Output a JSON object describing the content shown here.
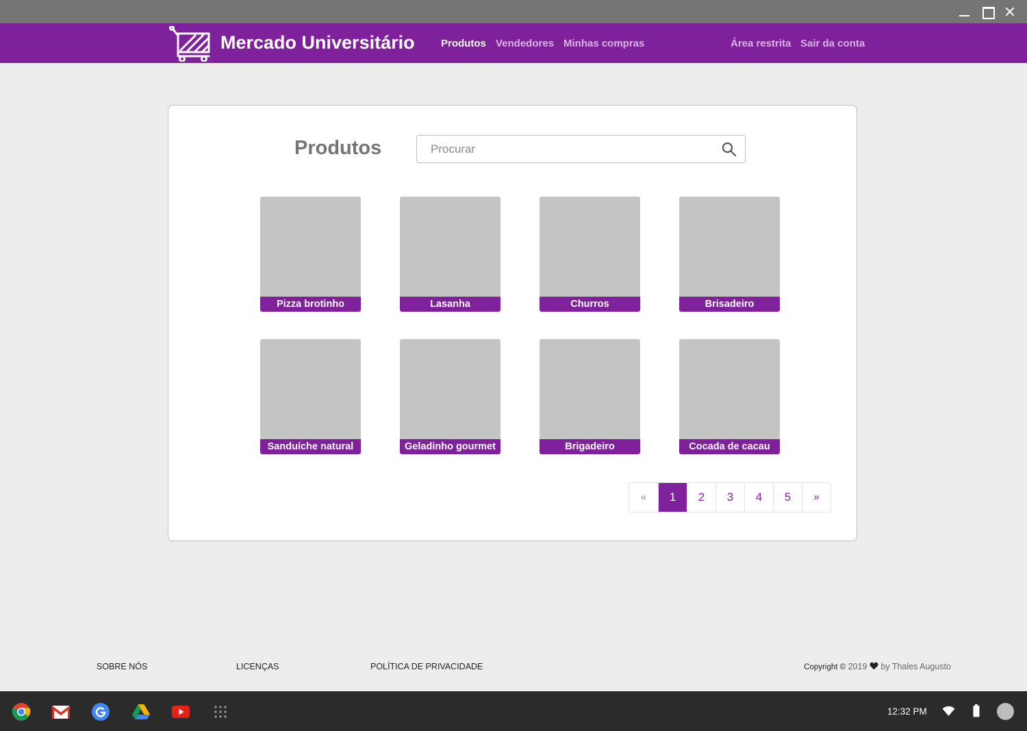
{
  "window": {
    "minimize_icon": "minimize-icon",
    "maximize_icon": "maximize-icon",
    "close_icon": "close-icon"
  },
  "navbar": {
    "brand": "Mercado Universitário",
    "logo_icon": "shopping-cart-icon",
    "links": [
      {
        "label": "Produtos",
        "active": true
      },
      {
        "label": "Vendedores",
        "active": false
      },
      {
        "label": "Minhas compras",
        "active": false
      }
    ],
    "right_links": [
      {
        "label": "Área restrita"
      },
      {
        "label": "Sair da conta"
      }
    ]
  },
  "main": {
    "heading": "Produtos",
    "search": {
      "placeholder": "Procurar",
      "value": "",
      "icon": "search-icon"
    },
    "products": [
      {
        "name": "Pizza brotinho"
      },
      {
        "name": "Lasanha"
      },
      {
        "name": "Churros"
      },
      {
        "name": "Brisadeiro"
      },
      {
        "name": "Sanduíche natural"
      },
      {
        "name": "Geladinho gourmet"
      },
      {
        "name": "Brigadeiro"
      },
      {
        "name": "Cocada de cacau"
      }
    ],
    "pagination": {
      "prev": "«",
      "pages": [
        "1",
        "2",
        "3",
        "4",
        "5"
      ],
      "current": "1",
      "next": "»"
    }
  },
  "footer": {
    "links": [
      "SOBRE NÓS",
      "LICENÇAS",
      "POLÍTICA DE PRIVACIDADE"
    ],
    "copyright_label": "Copyright ©",
    "copyright_year": "2019",
    "copyright_by": "by Thales Augusto"
  },
  "shelf": {
    "apps": [
      "chrome-icon",
      "gmail-icon",
      "google-search-icon",
      "drive-icon",
      "youtube-icon",
      "app-launcher-icon"
    ],
    "time": "12:32 PM",
    "status_icons": [
      "wifi-icon",
      "battery-icon",
      "account-avatar"
    ]
  },
  "colors": {
    "brand_purple": "#80219c",
    "nav_inactive": "#d8b3e3",
    "placeholder_gray": "#c4c4c4",
    "page_bg": "#ededed"
  }
}
